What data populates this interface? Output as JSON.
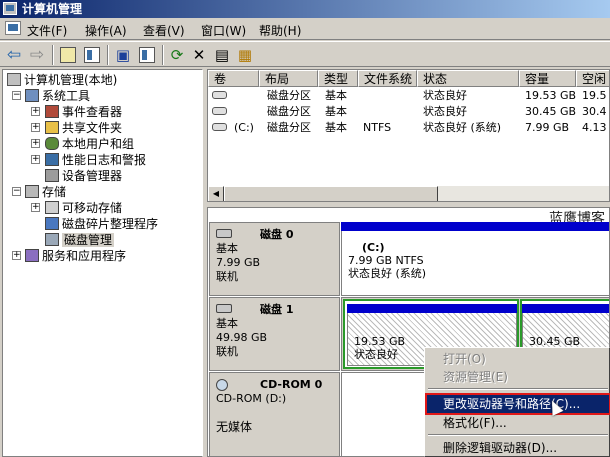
{
  "window": {
    "title": "计算机管理"
  },
  "menu": [
    "文件(F)",
    "操作(A)",
    "查看(V)",
    "窗口(W)",
    "帮助(H)"
  ],
  "toolbar_icons": [
    "back-arrow-icon",
    "forward-arrow-icon",
    "up-folder-icon",
    "show-tree-icon",
    "properties-icon",
    "help-icon",
    "refresh-icon",
    "delete-icon",
    "export-icon",
    "wizard-icon"
  ],
  "tree": {
    "root": "计算机管理(本地)",
    "system_tools": "系统工具",
    "event_viewer": "事件查看器",
    "shared_folders": "共享文件夹",
    "local_users": "本地用户和组",
    "perf_logs": "性能日志和警报",
    "device_manager": "设备管理器",
    "storage": "存储",
    "removable": "可移动存储",
    "defrag": "磁盘碎片整理程序",
    "disk_mgmt": "磁盘管理",
    "services": "服务和应用程序"
  },
  "list": {
    "headers": [
      "卷",
      "布局",
      "类型",
      "文件系统",
      "状态",
      "容量",
      "空闲"
    ],
    "rows": [
      {
        "vol": "",
        "layout": "磁盘分区",
        "type": "基本",
        "fs": "",
        "status": "状态良好",
        "cap": "19.53 GB",
        "free": "19.5"
      },
      {
        "vol": "",
        "layout": "磁盘分区",
        "type": "基本",
        "fs": "",
        "status": "状态良好",
        "cap": "30.45 GB",
        "free": "30.4"
      },
      {
        "vol": "(C:)",
        "layout": "磁盘分区",
        "type": "基本",
        "fs": "NTFS",
        "status": "状态良好 (系统)",
        "cap": "7.99 GB",
        "free": "4.13"
      }
    ]
  },
  "watermark": "蓝鹰博客",
  "disks": {
    "disk0": {
      "name": "磁盘 0",
      "type": "基本",
      "size": "7.99 GB",
      "state": "联机",
      "part": {
        "label": "(C:)",
        "size": "7.99 GB NTFS",
        "status": "状态良好 (系统)"
      }
    },
    "disk1": {
      "name": "磁盘 1",
      "type": "基本",
      "size": "49.98 GB",
      "state": "联机",
      "p1": {
        "size": "19.53 GB",
        "status": "状态良好"
      },
      "p2": {
        "size": "30.45 GB"
      }
    },
    "cdrom": {
      "name": "CD-ROM 0",
      "type": "CD-ROM (D:)",
      "state": "无媒体"
    }
  },
  "context_menu": {
    "open": "打开(O)",
    "explore": "资源管理(E)",
    "change_letter": "更改驱动器号和路径(C)...",
    "format": "格式化(F)...",
    "delete": "删除逻辑驱动器(D)..."
  }
}
